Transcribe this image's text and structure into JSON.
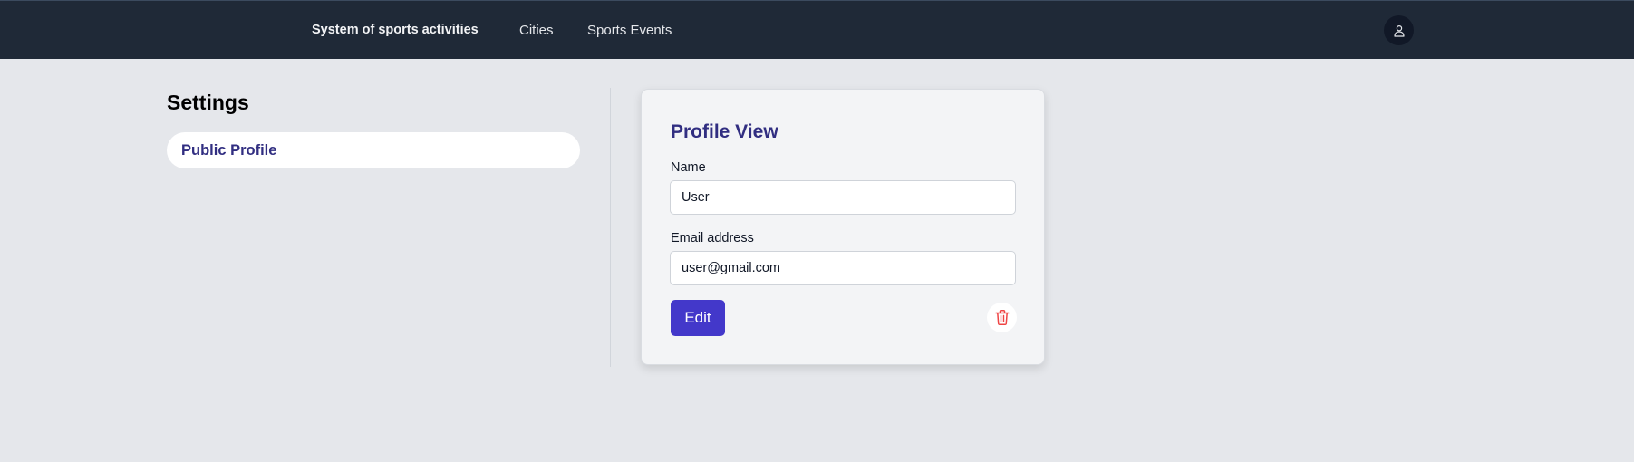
{
  "navbar": {
    "brand": "System of sports activities",
    "links": [
      "Cities",
      "Sports Events"
    ],
    "user_icon": "user-icon"
  },
  "sidebar": {
    "title": "Settings",
    "items": [
      {
        "label": "Public Profile",
        "active": true
      }
    ]
  },
  "profile_card": {
    "title": "Profile View",
    "name_label": "Name",
    "name_value": "User",
    "email_label": "Email address",
    "email_value": "user@gmail.com",
    "edit_label": "Edit",
    "delete_icon": "trash-icon"
  },
  "colors": {
    "navbar_bg": "#1f2937",
    "page_bg": "#e5e7eb",
    "accent": "#4338ca",
    "heading": "#312e81",
    "danger": "#ef4444"
  }
}
